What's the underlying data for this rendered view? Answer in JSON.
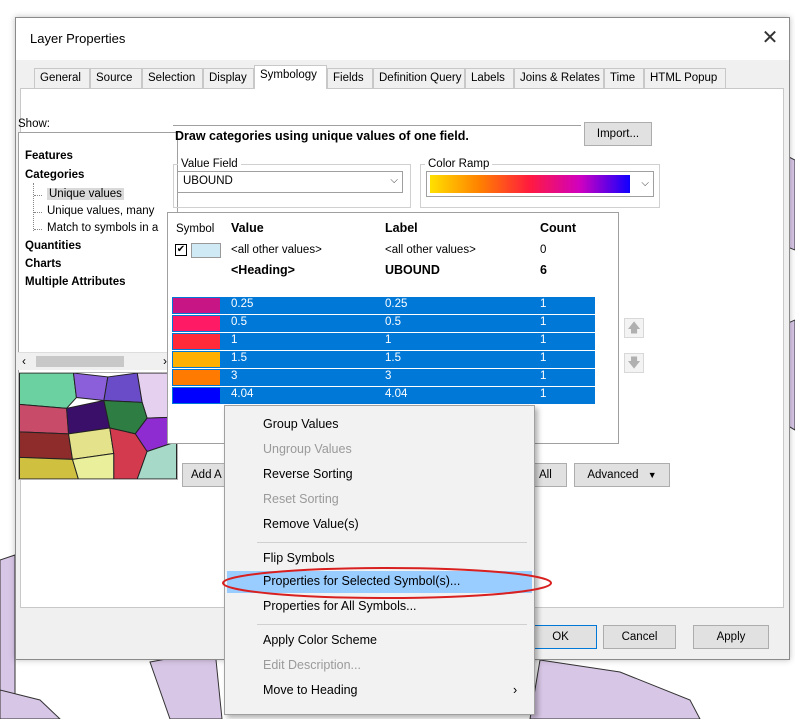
{
  "dialog": {
    "title": "Layer Properties",
    "close_icon": "close-icon",
    "tabs": [
      "General",
      "Source",
      "Selection",
      "Display",
      "Symbology",
      "Fields",
      "Definition Query",
      "Labels",
      "Joins & Relates",
      "Time",
      "HTML Popup"
    ],
    "active_tab": "Symbology"
  },
  "show": {
    "label": "Show:",
    "tree": [
      {
        "label": "Features",
        "bold": true
      },
      {
        "label": "Categories",
        "bold": true
      },
      {
        "label": "Unique values",
        "bold": false,
        "selected": true
      },
      {
        "label": "Unique values, many",
        "bold": false
      },
      {
        "label": "Match to symbols in a",
        "bold": false
      },
      {
        "label": "Quantities",
        "bold": true
      },
      {
        "label": "Charts",
        "bold": true
      },
      {
        "label": "Multiple Attributes",
        "bold": true
      }
    ]
  },
  "symbology": {
    "description": "Draw categories using unique values of one field.",
    "import_label": "Import...",
    "value_field_title": "Value Field",
    "value_field": "UBOUND",
    "color_ramp_title": "Color Ramp",
    "table": {
      "headers": {
        "symbol": "Symbol",
        "value": "Value",
        "label": "Label",
        "count": "Count"
      },
      "other_row": {
        "value": "<all other values>",
        "label": "<all other values>",
        "count": "0"
      },
      "heading_row": {
        "value": "<Heading>",
        "label": "UBOUND",
        "count": "6"
      },
      "rows": [
        {
          "value": "0.25",
          "label": "0.25",
          "count": "1",
          "color": "#c71585"
        },
        {
          "value": "0.5",
          "label": "0.5",
          "count": "1",
          "color": "#ff1a66"
        },
        {
          "value": "1",
          "label": "1",
          "count": "1",
          "color": "#ff2a3a"
        },
        {
          "value": "1.5",
          "label": "1.5",
          "count": "1",
          "color": "#ffb000"
        },
        {
          "value": "3",
          "label": "3",
          "count": "1",
          "color": "#ff7a00"
        },
        {
          "value": "4.04",
          "label": "4.04",
          "count": "1",
          "color": "#0000ff"
        }
      ]
    },
    "move_up_icon": "arrow-up-icon",
    "move_down_icon": "arrow-down-icon",
    "add_label": "Add A",
    "remove_all_label": "All",
    "advanced_label": "Advanced"
  },
  "footer": {
    "ok": "OK",
    "cancel": "Cancel",
    "apply": "Apply"
  },
  "context_menu": {
    "items": [
      {
        "label": "Group Values",
        "disabled": false
      },
      {
        "label": "Ungroup Values",
        "disabled": true
      },
      {
        "label": "Reverse Sorting",
        "disabled": false
      },
      {
        "label": "Reset Sorting",
        "disabled": true
      },
      {
        "label": "Remove Value(s)",
        "disabled": false
      },
      {
        "label": "Flip Symbols",
        "disabled": false
      },
      {
        "label": "Properties for Selected Symbol(s)...",
        "disabled": false,
        "highlighted": true
      },
      {
        "label": "Properties for All Symbols...",
        "disabled": false
      },
      {
        "label": "Apply Color Scheme",
        "disabled": false
      },
      {
        "label": "Edit Description...",
        "disabled": true
      },
      {
        "label": "Move to Heading",
        "disabled": false,
        "submenu": true
      }
    ]
  },
  "colors": {
    "selection": "#0078d7",
    "menu_highlight": "#99ccff",
    "annotation": "#d92020"
  }
}
